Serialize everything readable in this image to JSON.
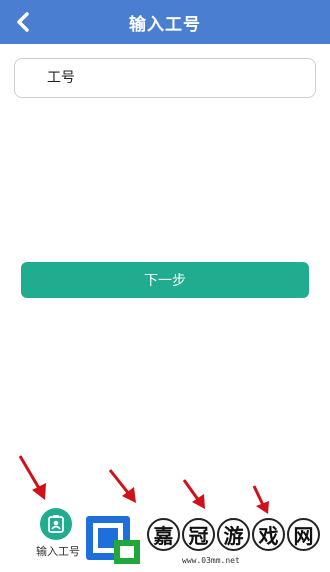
{
  "header": {
    "title": "输入工号",
    "back_icon": "chevron-left-icon",
    "background": "#4a7ed1"
  },
  "form": {
    "employee_id_placeholder": "工号",
    "employee_id_value": "",
    "next_label": "下一步",
    "accent": "#20ac8e"
  },
  "steps": {
    "step1_label": "输入工号",
    "step1_icon": "badge-person-icon",
    "annotation_color": "#d0111a"
  },
  "watermark": {
    "chars": [
      "嘉",
      "冠",
      "游",
      "戏",
      "网"
    ],
    "url": "www.03mm.net"
  }
}
